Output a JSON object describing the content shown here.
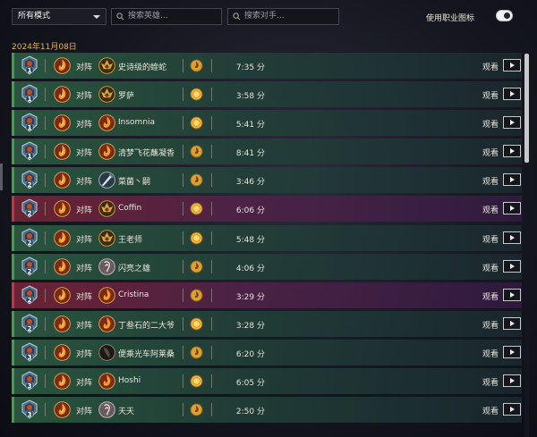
{
  "filters": {
    "mode_select": "所有模式",
    "search_hero_placeholder": "搜索英雄...",
    "search_opponent_placeholder": "搜索对手...",
    "toggle_label": "使用职业图标",
    "toggle_on": true
  },
  "date_header": "2024年11月08日",
  "colors": {
    "win": "#3ea14a",
    "loss": "#c8343d",
    "date": "#e6b44a"
  },
  "games": [
    {
      "result": "win",
      "rank": "1",
      "vs": "对阵",
      "opponent_icon": "warlock-icon",
      "opponent": "史诗级的蝰蛇",
      "coin": "second",
      "duration": "7:35 分",
      "watch": "观看"
    },
    {
      "result": "win",
      "rank": "1",
      "vs": "对阵",
      "opponent_icon": "warlock-icon",
      "opponent": "罗萨",
      "coin": "first",
      "duration": "3:58 分",
      "watch": "观看"
    },
    {
      "result": "win",
      "rank": "1",
      "vs": "对阵",
      "opponent_icon": "mage-icon",
      "opponent": "Insomnia",
      "coin": "first",
      "duration": "5:41 分",
      "watch": "观看"
    },
    {
      "result": "win",
      "rank": "1",
      "vs": "对阵",
      "opponent_icon": "mage-icon",
      "opponent": "清梦飞花蘸凝香",
      "coin": "second",
      "duration": "8:41 分",
      "watch": "观看"
    },
    {
      "result": "win",
      "rank": "2",
      "vs": "对阵",
      "opponent_icon": "warrior-icon",
      "opponent": "菜菌丶嗣",
      "coin": "second",
      "duration": "3:46 分",
      "watch": "观看"
    },
    {
      "result": "loss",
      "rank": "2",
      "vs": "对阵",
      "opponent_icon": "warlock-icon",
      "opponent": "Coffin",
      "coin": "first",
      "duration": "6:06 分",
      "watch": "观看"
    },
    {
      "result": "win",
      "rank": "2",
      "vs": "对阵",
      "opponent_icon": "warlock-icon",
      "opponent": "王老师",
      "coin": "first",
      "duration": "5:48 分",
      "watch": "观看"
    },
    {
      "result": "win",
      "rank": "2",
      "vs": "对阵",
      "opponent_icon": "priest-icon",
      "opponent": "闪亮之雄",
      "coin": "second",
      "duration": "4:06 分",
      "watch": "观看"
    },
    {
      "result": "loss",
      "rank": "2",
      "vs": "对阵",
      "opponent_icon": "mage-icon",
      "opponent": "Cristina",
      "coin": "second",
      "duration": "3:29 分",
      "watch": "观看"
    },
    {
      "result": "win",
      "rank": "2",
      "vs": "对阵",
      "opponent_icon": "mage-icon",
      "opponent": "丁叁石的二大爷",
      "coin": "first",
      "duration": "3:28 分",
      "watch": "观看"
    },
    {
      "result": "win",
      "rank": "3",
      "vs": "对阵",
      "opponent_icon": "rogue-icon",
      "opponent": "便乘光车阿莱桑",
      "coin": "second",
      "duration": "6:20 分",
      "watch": "观看"
    },
    {
      "result": "win",
      "rank": "3",
      "vs": "对阵",
      "opponent_icon": "mage-icon",
      "opponent": "Hoshi",
      "coin": "first",
      "duration": "6:05 分",
      "watch": "观看"
    },
    {
      "result": "win",
      "rank": "3",
      "vs": "对阵",
      "opponent_icon": "priest-icon",
      "opponent": "天天",
      "coin": "second",
      "duration": "2:50 分",
      "watch": "观看"
    }
  ]
}
